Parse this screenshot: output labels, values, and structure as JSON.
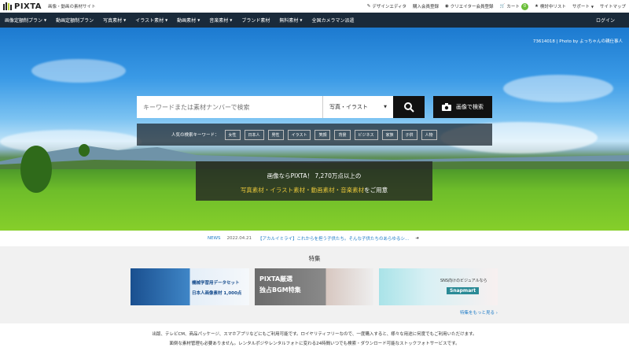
{
  "header": {
    "logo_text": "PIXTA",
    "tagline": "画像・動画の素材サイト",
    "links": [
      {
        "label": "デザインエディタ",
        "icon": "pencil-icon"
      },
      {
        "label": "購入会員登録",
        "icon": ""
      },
      {
        "label": "クリエイター会員登録",
        "icon": "camera-icon"
      },
      {
        "label": "カート",
        "icon": "cart-icon"
      },
      {
        "label": "検討中リスト",
        "icon": "star-icon"
      },
      {
        "label": "サポート",
        "icon": ""
      },
      {
        "label": "サイトマップ",
        "icon": ""
      }
    ],
    "cart_count": "0"
  },
  "nav": {
    "items": [
      {
        "label": "画像定額制プラン",
        "caret": true
      },
      {
        "label": "動画定額制プラン",
        "caret": false
      },
      {
        "label": "写真素材",
        "caret": true
      },
      {
        "label": "イラスト素材",
        "caret": true
      },
      {
        "label": "動画素材",
        "caret": true
      },
      {
        "label": "音楽素材",
        "caret": true
      },
      {
        "label": "ブランド素材",
        "caret": false
      },
      {
        "label": "無料素材",
        "caret": true
      },
      {
        "label": "全国カメラマン派遣",
        "caret": false
      }
    ],
    "login_label": "ログイン"
  },
  "hero": {
    "credit": "73614018 | Photo by よっちゃんの親仕事人",
    "search_placeholder": "キーワードまたは素材ナンバーで検索",
    "search_type": "写真・イラスト",
    "image_search_label": "画像で検索",
    "keywords_label": "人気の検索キーワード：",
    "keywords": [
      "女性",
      "日本人",
      "男性",
      "イラスト",
      "笑顔",
      "背景",
      "ビジネス",
      "家族",
      "子供",
      "人物"
    ],
    "banner_line1": "画像ならPIXTA！ 7,270万点以上の",
    "banner_line2_highlight": "写真素材・イラスト素材・動画素材・音楽素材",
    "banner_line2_suffix": "をご用意"
  },
  "news": {
    "tag": "NEWS",
    "date": "2022.04.21",
    "text": "【アカルイミライ】これからを担う子供たち。そんな子供たちのあらゆるシ..."
  },
  "features": {
    "title": "特集",
    "cards": [
      {
        "line1": "機械学習用データセット",
        "line2": "日本人画像素材 1,000点"
      },
      {
        "line1": "PIXTA厳選",
        "line2": "独占BGM特集"
      },
      {
        "line1": "SNS向けのビジュアルなら",
        "line2": "Snapmart"
      }
    ],
    "more_label": "特集をもっと見る ›"
  },
  "description": {
    "line1": "出版、テレビCM、商品パッケージ、スマホアプリなどにもご利用可能です。ロイヤリティフリーなので、一度購入すると、様々な用途に何度でもご利用いただけます。",
    "line2": "面倒な素材管理も必要ありません。レンタルポジやレンタルフォトに変わる24時間いつでも検索・ダウンロード可能なストックフォトサービスです。"
  }
}
